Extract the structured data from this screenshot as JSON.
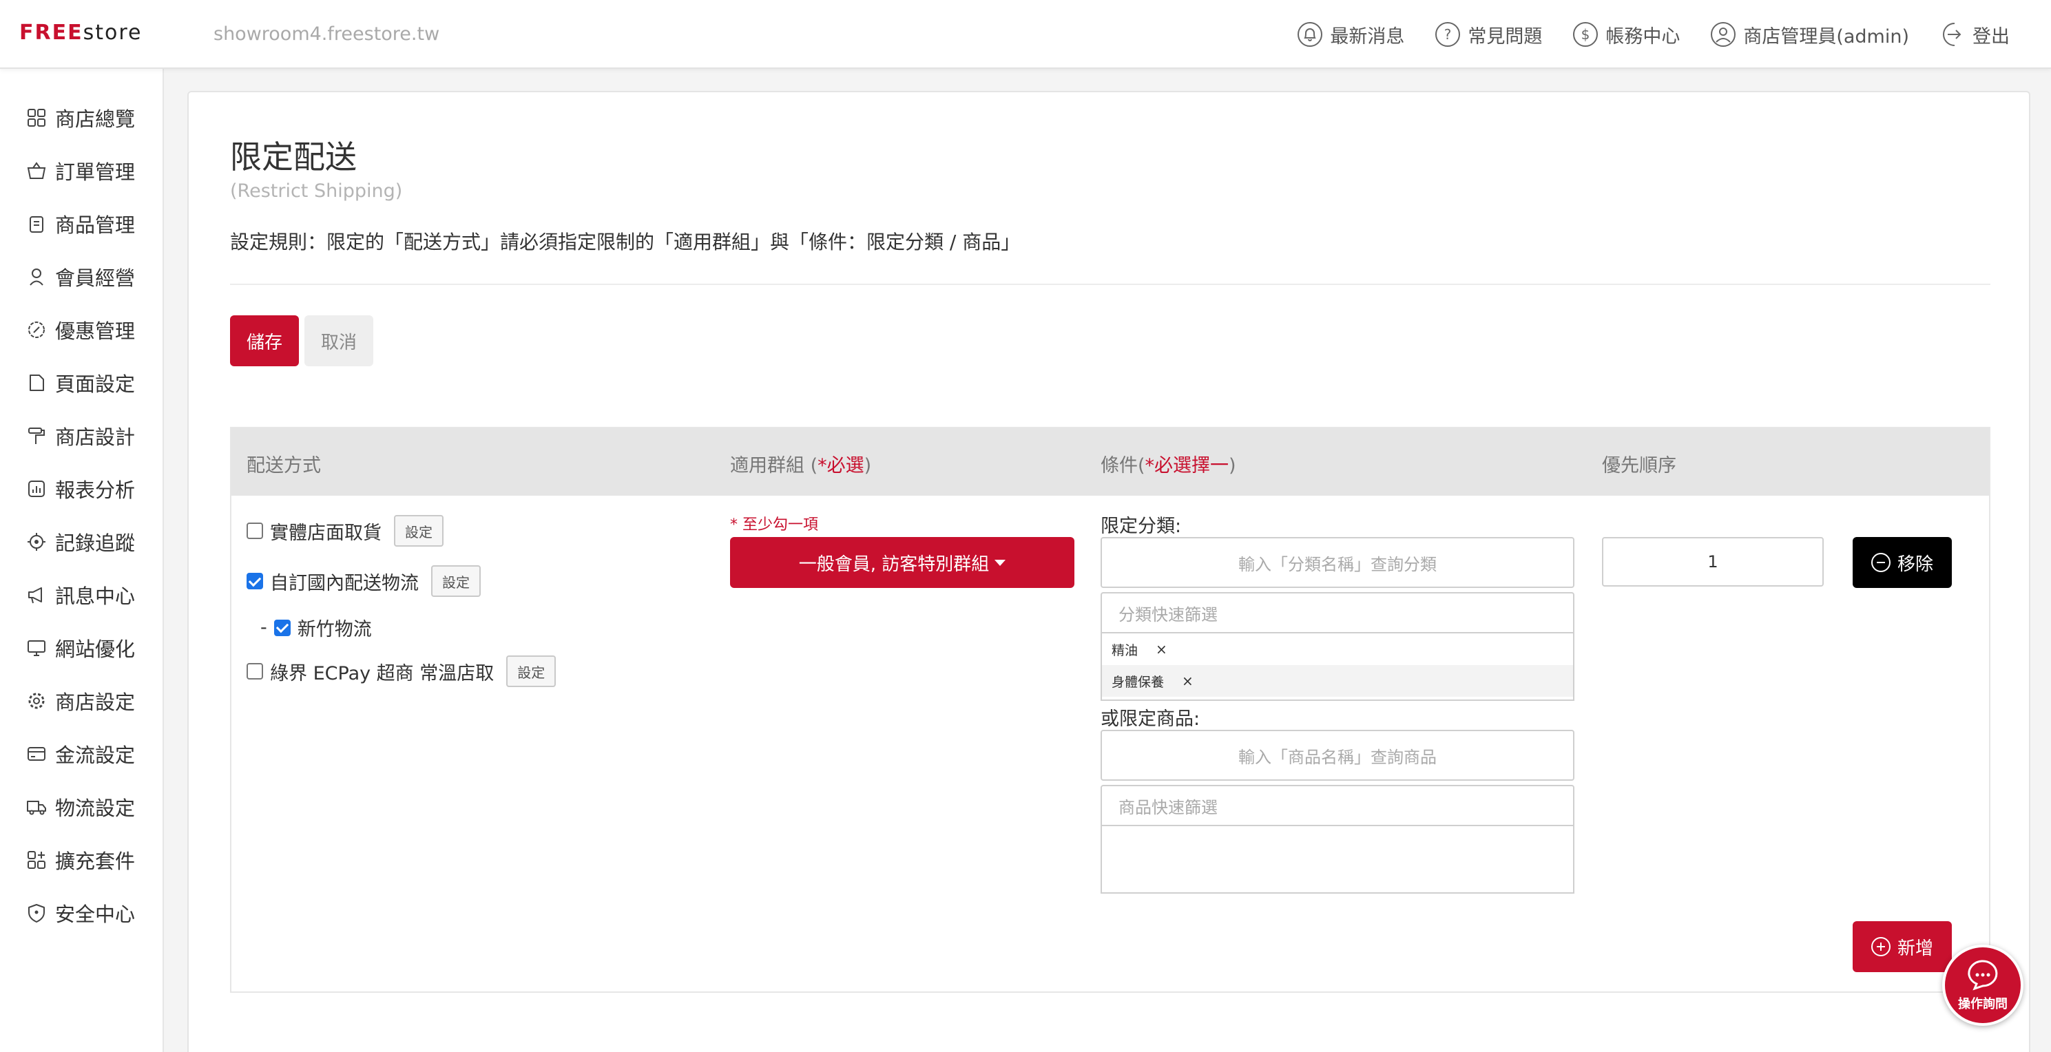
{
  "header": {
    "logo_accent": "FREE",
    "logo_rest": "store",
    "domain": "showroom4.freestore.tw",
    "nav": [
      {
        "label": "最新消息",
        "icon": "bell-icon"
      },
      {
        "label": "常見問題",
        "icon": "question-icon"
      },
      {
        "label": "帳務中心",
        "icon": "dollar-icon"
      },
      {
        "label": "商店管理員(admin)",
        "icon": "user-icon"
      },
      {
        "label": "登出",
        "icon": "logout-icon"
      }
    ]
  },
  "sidebar": {
    "items": [
      {
        "label": "商店總覽",
        "icon": "dashboard-icon"
      },
      {
        "label": "訂單管理",
        "icon": "basket-icon"
      },
      {
        "label": "商品管理",
        "icon": "clipboard-icon"
      },
      {
        "label": "會員經營",
        "icon": "member-icon"
      },
      {
        "label": "優惠管理",
        "icon": "discount-icon"
      },
      {
        "label": "頁面設定",
        "icon": "page-icon"
      },
      {
        "label": "商店設計",
        "icon": "paint-roller-icon"
      },
      {
        "label": "報表分析",
        "icon": "chart-icon"
      },
      {
        "label": "記錄追蹤",
        "icon": "target-icon"
      },
      {
        "label": "訊息中心",
        "icon": "megaphone-icon"
      },
      {
        "label": "網站優化",
        "icon": "monitor-icon"
      },
      {
        "label": "商店設定",
        "icon": "gear-icon"
      },
      {
        "label": "金流設定",
        "icon": "card-icon"
      },
      {
        "label": "物流設定",
        "icon": "truck-icon"
      },
      {
        "label": "擴充套件",
        "icon": "plugin-icon"
      },
      {
        "label": "安全中心",
        "icon": "shield-icon"
      }
    ]
  },
  "page": {
    "title": "限定配送",
    "subtitle": "(Restrict Shipping)",
    "rule": "設定規則：限定的「配送方式」請必須指定限制的「適用群組」與「條件：限定分類 / 商品」",
    "save": "儲存",
    "cancel": "取消"
  },
  "table": {
    "headers": {
      "shipping": "配送方式",
      "group_prefix": "適用群組 (",
      "group_req": "*必選",
      "group_suffix": ")",
      "cond_prefix": "條件(",
      "cond_req": "*必選擇一",
      "cond_suffix": ")",
      "priority": "優先順序"
    },
    "shipping_methods": [
      {
        "label": "實體店面取貨",
        "checked": false,
        "set": "設定"
      },
      {
        "label": "自訂國內配送物流",
        "checked": true,
        "set": "設定"
      },
      {
        "label": "新竹物流",
        "checked": true,
        "prefix": "-"
      },
      {
        "label": "綠界 ECPay 超商 常溫店取",
        "checked": false,
        "set": "設定"
      }
    ],
    "group_hint": "* 至少勾一項",
    "group_button": "一般會員, 訪客特別群組",
    "category_label": "限定分類:",
    "category_search_placeholder": "輸入「分類名稱」查詢分類",
    "category_filter_placeholder": "分類快速篩選",
    "category_tags": [
      "精油",
      "身體保養"
    ],
    "tag_remove": "×",
    "product_label": "或限定商品:",
    "product_search_placeholder": "輸入「商品名稱」查詢商品",
    "product_filter_placeholder": "商品快速篩選",
    "priority_value": "1",
    "remove": "移除",
    "add": "新增"
  },
  "help": {
    "label": "操作詢問"
  },
  "colors": {
    "accent": "#c8102e",
    "black_button": "#000000",
    "checkbox": "#1a73e8"
  }
}
